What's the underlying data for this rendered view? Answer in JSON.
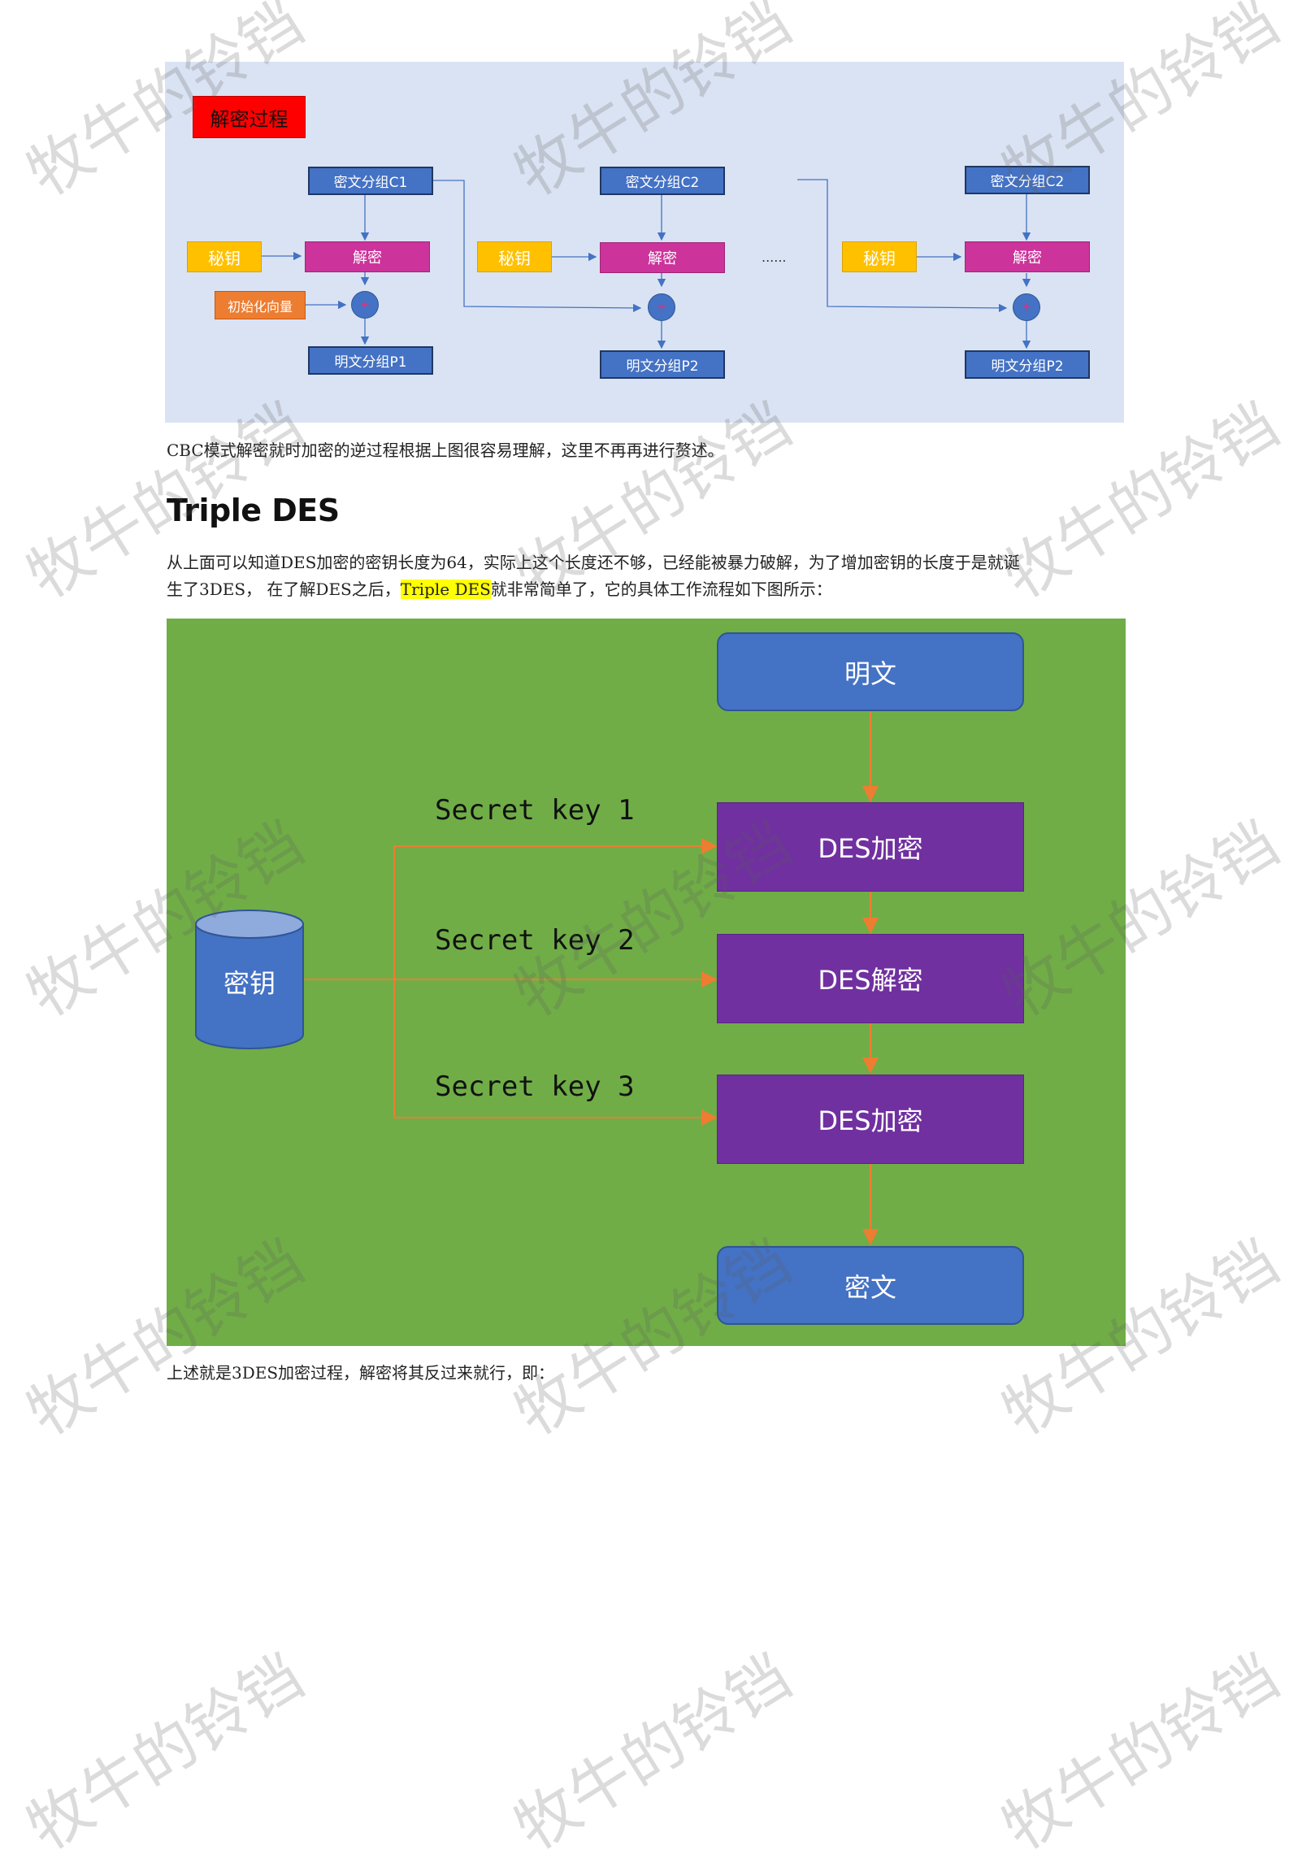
{
  "cbc_figure": {
    "title": "解密过程",
    "blocks": [
      {
        "cipher": "密文分组C1",
        "key": "秘钥",
        "decrypt": "解密",
        "plain": "明文分组P1",
        "iv": "初始化向量"
      },
      {
        "cipher": "密文分组C2",
        "key": "秘钥",
        "decrypt": "解密",
        "plain": "明文分组P2"
      },
      {
        "cipher": "密文分组C2",
        "key": "秘钥",
        "decrypt": "解密",
        "plain": "明文分组P2"
      }
    ],
    "ellipsis": "......",
    "xor_symbol": "+"
  },
  "caption_cbc": "CBC模式解密就时加密的逆过程根据上图很容易理解，这里不再再进行赘述。",
  "heading": "Triple DES",
  "paragraph": {
    "line1": "从上面可以知道DES加密的密钥长度为64，实际上这个长度还不够，已经能被暴力破解，为了增加密钥的长度于是就诞",
    "line2_a": "生了3DES， 在了解DES之后，",
    "line2_highlight": "Triple DES",
    "line2_b": "就非常简单了，它的具体工作流程如下图所示："
  },
  "des_figure": {
    "plaintext": "明文",
    "ciphertext": "密文",
    "key": "密钥",
    "stages": [
      "DES加密",
      "DES解密",
      "DES加密"
    ],
    "secret_keys": [
      "Secret key 1",
      "Secret key 2",
      "Secret key 3"
    ]
  },
  "caption_des": "上述就是3DES加密过程，解密将其反过来就行，即：",
  "watermark": "牧牛的铃铛",
  "colors": {
    "cbc_bg": "#dae3f3",
    "cipher_blue": "#4472c4",
    "decrypt_magenta": "#cc339b",
    "key_yellow": "#ffc000",
    "iv_orange": "#ed7d31",
    "des_bg": "#70ad47",
    "des_purple": "#7030a0",
    "arrow_orange": "#ed7d31",
    "highlight": "#ffff00"
  }
}
